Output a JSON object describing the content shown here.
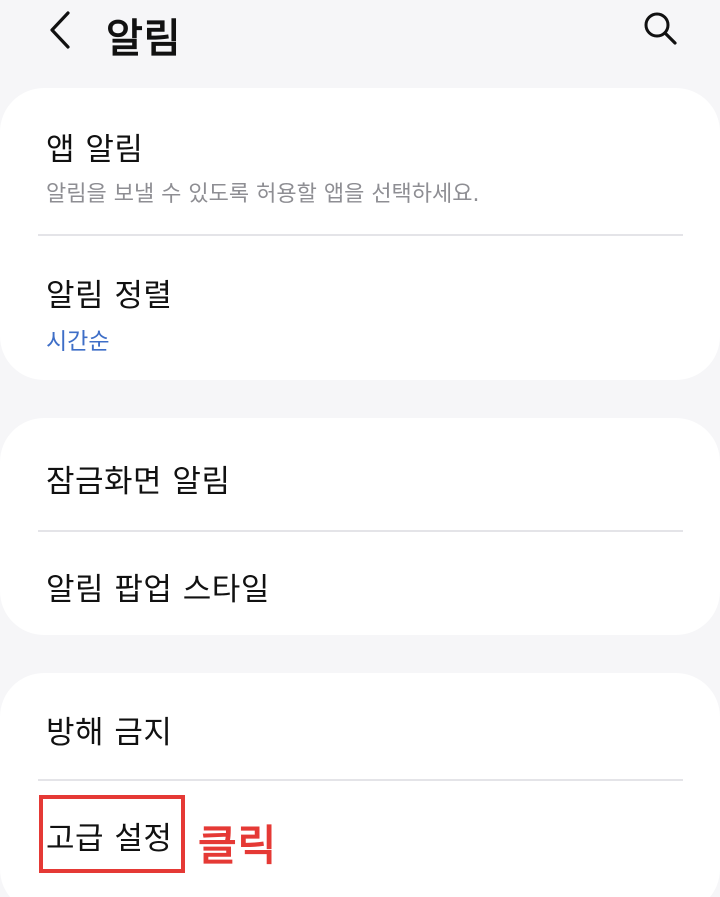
{
  "header": {
    "title": "알림",
    "back_icon": "chevron-left-icon",
    "search_icon": "search-icon"
  },
  "groups": [
    {
      "items": [
        {
          "title": "앱 알림",
          "subtitle": "알림을 보낼 수 있도록 허용할 앱을 선택하세요."
        },
        {
          "title": "알림 정렬",
          "value": "시간순"
        }
      ]
    },
    {
      "items": [
        {
          "title": "잠금화면 알림"
        },
        {
          "title": "알림 팝업 스타일"
        }
      ]
    },
    {
      "items": [
        {
          "title": "방해 금지"
        },
        {
          "title": "고급 설정"
        }
      ]
    }
  ],
  "annotation": {
    "label": "클릭",
    "color": "#e53935"
  },
  "colors": {
    "background": "#f6f6f8",
    "card": "#ffffff",
    "accent_value": "#3e6ec7",
    "subtitle": "#8e8e93"
  }
}
